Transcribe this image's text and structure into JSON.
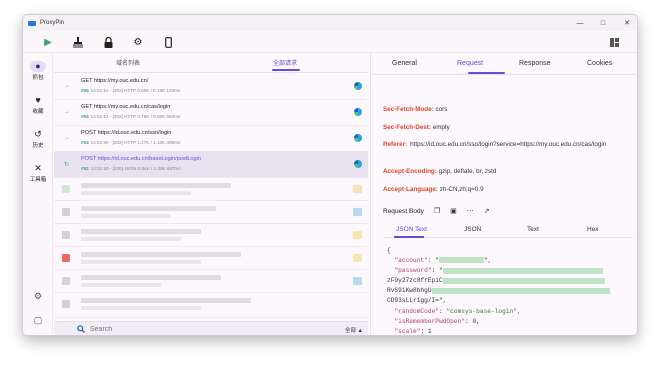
{
  "window": {
    "title": "ProxyPin",
    "controls": [
      "minimize-icon",
      "maximize-icon",
      "close-icon"
    ]
  },
  "toolbar": {
    "icons": [
      "play-icon",
      "broom-icon",
      "lock-icon",
      "gear-icon",
      "phone-icon",
      "layout-icon"
    ]
  },
  "nav": {
    "items": [
      {
        "label": "抓包",
        "icon": "network-icon"
      },
      {
        "label": "收藏",
        "icon": "heart-icon"
      },
      {
        "label": "历史",
        "icon": "history-icon"
      },
      {
        "label": "工具箱",
        "icon": "tools-icon"
      }
    ],
    "footer_icons": [
      "settings-icon",
      "feedback-icon"
    ]
  },
  "left_tabs": {
    "domain_list": "域名列表",
    "all_requests": "全部请求"
  },
  "requests": [
    {
      "line1": "GET https://my.ouc.edu.cn/",
      "id": "#55",
      "meta": "14:01:51 - [302]  HTTP 0.66K / 0.19K  103ms"
    },
    {
      "line1": "GET https://my.ouc.edu.cn/cas/login",
      "id": "#54",
      "meta": "14:01:51 - [302]  HTTP 0.79K / 0.58K  563ms"
    },
    {
      "line1": "POST https://id.ouc.edu.cn/sso/login",
      "id": "#53",
      "meta": "14:01:50 - [302]  HTTP 1.27K / 1.10K  406ms"
    },
    {
      "line1": "POST https://id.ouc.edu.cn/baseLogin/postLogin",
      "id": "#52",
      "meta": "14:01:50 - [200]  JSON 0.84K / 1.33K  657ms"
    }
  ],
  "search": {
    "placeholder": "Search",
    "filter": "全部 ▲"
  },
  "detail_tabs": {
    "general": "General",
    "request": "Request",
    "response": "Response",
    "cookies": "Cookies"
  },
  "headers": [
    {
      "key": "Sec-Fetch-Mode:",
      "value": "cors"
    },
    {
      "key": "Sec-Fetch-Dest:",
      "value": "empty"
    },
    {
      "key": "Referer:",
      "value": "https://id.ouc.edu.cn/sso/login?service=https://my.ouc.edu.cn/cas/login"
    },
    {
      "key": "Accept-Encoding:",
      "value": "gzip, deflate, br, zstd"
    },
    {
      "key": "Accept-Language:",
      "value": "zh-CN,zh;q=0.9"
    }
  ],
  "body": {
    "label": "Request Body",
    "icons": [
      "copy-icon",
      "file-icon",
      "more-icon",
      "open-external-icon"
    ]
  },
  "format_tabs": {
    "json_text": "JSON Text",
    "json": "JSON",
    "text": "Text",
    "hex": "Hex"
  },
  "json_body": {
    "open": "{",
    "account_key": "\"account\"",
    "account_tail": "\",",
    "password_key": "\"password\"",
    "password_open": "\"",
    "pw2": "zF9y27zc8frEpiC",
    "pw3": "RvS9iKw8bhgU",
    "pw4": "CD93sLLr1gg/I=\",",
    "randomcode_key": "\"randomCode\"",
    "randomcode_val": "\"comsys-base-login\",",
    "remember_key": "\"isRememberPwdOpen\"",
    "remember_val": "0,",
    "scale_key": "\"scale\"",
    "scale_val": "1",
    "close": "}"
  }
}
